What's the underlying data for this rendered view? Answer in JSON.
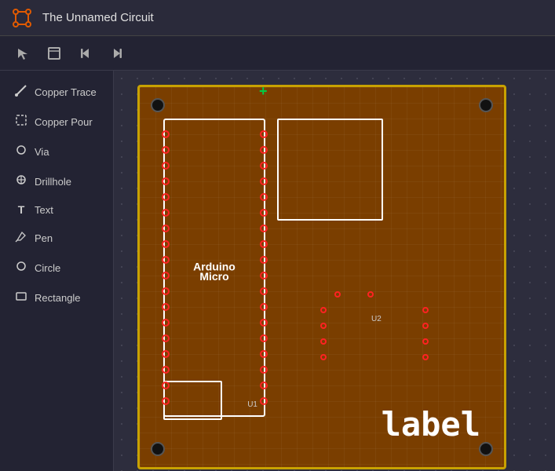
{
  "titleBar": {
    "title": "The Unnamed Circuit",
    "logoLabel": "circuit-logo"
  },
  "toolbar": {
    "buttons": [
      {
        "name": "select-tool",
        "icon": "⬚",
        "label": "Select"
      },
      {
        "name": "frame-tool",
        "icon": "⬜",
        "label": "Frame"
      },
      {
        "name": "step-back",
        "icon": "◀",
        "label": "Step Back"
      },
      {
        "name": "step-forward",
        "icon": "▶",
        "label": "Step Forward"
      }
    ]
  },
  "sidebar": {
    "items": [
      {
        "name": "copper-trace",
        "label": "Copper Trace",
        "icon": "✏"
      },
      {
        "name": "copper-pour",
        "label": "Copper Pour",
        "icon": "⬚"
      },
      {
        "name": "via",
        "label": "Via",
        "icon": "○"
      },
      {
        "name": "drillhole",
        "label": "Drillhole",
        "icon": "⊕"
      },
      {
        "name": "text",
        "label": "Text",
        "icon": "T"
      },
      {
        "name": "pen",
        "label": "Pen",
        "icon": "✒"
      },
      {
        "name": "circle",
        "label": "Circle",
        "icon": "○"
      },
      {
        "name": "rectangle",
        "label": "Rectangle",
        "icon": "□"
      }
    ]
  },
  "canvas": {
    "boardLabel": "label",
    "arduinoLabel": "Arduino",
    "arduinoSub": "Micro",
    "arduinoRef": "U1",
    "u2Ref": "U2"
  },
  "colors": {
    "boardFill": "#7a3e00",
    "boardBorder": "#c8a200",
    "padColor": "#ff2222",
    "componentBorder": "#ffffff",
    "accent": "#e05a00"
  }
}
